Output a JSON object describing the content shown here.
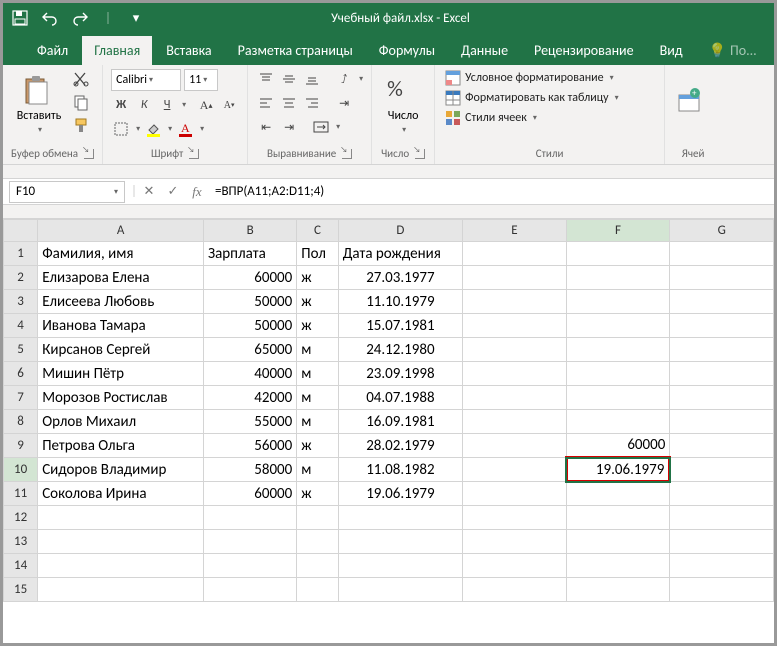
{
  "title": "Учебный файл.xlsx - Excel",
  "tabs": [
    "Файл",
    "Главная",
    "Вставка",
    "Разметка страницы",
    "Формулы",
    "Данные",
    "Рецензирование",
    "Вид"
  ],
  "search": "По...",
  "ribbon": {
    "clipboard": {
      "paste": "Вставить",
      "label": "Буфер обмена"
    },
    "font": {
      "name": "Calibri",
      "size": "11",
      "bold": "Ж",
      "italic": "К",
      "underline": "Ч",
      "label": "Шрифт"
    },
    "align": {
      "label": "Выравнивание"
    },
    "number": {
      "btn": "Число",
      "label": "Число"
    },
    "styles": {
      "cond": "Условное форматирование",
      "table": "Форматировать как таблицу",
      "cell": "Стили ячеек",
      "label": "Стили"
    },
    "cells": {
      "label": "Ячей"
    }
  },
  "namebox": "F10",
  "formula": "=ВПР(A11;A2:D11;4)",
  "cols": [
    "",
    "A",
    "B",
    "C",
    "D",
    "E",
    "F",
    "G"
  ],
  "rows": [
    {
      "n": 1,
      "A": "Фамилия, имя",
      "B": "Зарплата",
      "C": "Пол",
      "D": "Дата рождения",
      "E": "",
      "F": "",
      "al": {
        "B": "",
        "D": ""
      }
    },
    {
      "n": 2,
      "A": "Елизарова Елена",
      "B": "60000",
      "C": "ж",
      "D": "27.03.1977",
      "E": "",
      "F": ""
    },
    {
      "n": 3,
      "A": "Елисеева Любовь",
      "B": "50000",
      "C": "ж",
      "D": "11.10.1979",
      "E": "",
      "F": ""
    },
    {
      "n": 4,
      "A": "Иванова Тамара",
      "B": "50000",
      "C": "ж",
      "D": "15.07.1981",
      "E": "",
      "F": ""
    },
    {
      "n": 5,
      "A": "Кирсанов Сергей",
      "B": "65000",
      "C": "м",
      "D": "24.12.1980",
      "E": "",
      "F": ""
    },
    {
      "n": 6,
      "A": "Мишин Пётр",
      "B": "40000",
      "C": "м",
      "D": "23.09.1998",
      "E": "",
      "F": ""
    },
    {
      "n": 7,
      "A": "Морозов Ростислав",
      "B": "42000",
      "C": "м",
      "D": "04.07.1988",
      "E": "",
      "F": ""
    },
    {
      "n": 8,
      "A": "Орлов Михаил",
      "B": "55000",
      "C": "м",
      "D": "16.09.1981",
      "E": "",
      "F": ""
    },
    {
      "n": 9,
      "A": "Петрова Ольга",
      "B": "56000",
      "C": "ж",
      "D": "28.02.1979",
      "E": "",
      "F": "60000"
    },
    {
      "n": 10,
      "A": "Сидоров Владимир",
      "B": "58000",
      "C": "м",
      "D": "11.08.1982",
      "E": "",
      "F": "19.06.1979",
      "sel": true,
      "hl": true
    },
    {
      "n": 11,
      "A": "Соколова Ирина",
      "B": "60000",
      "C": "ж",
      "D": "19.06.1979",
      "E": "",
      "F": ""
    },
    {
      "n": 12,
      "A": "",
      "B": "",
      "C": "",
      "D": "",
      "E": "",
      "F": ""
    },
    {
      "n": 13,
      "A": "",
      "B": "",
      "C": "",
      "D": "",
      "E": "",
      "F": ""
    },
    {
      "n": 14,
      "A": "",
      "B": "",
      "C": "",
      "D": "",
      "E": "",
      "F": ""
    },
    {
      "n": 15,
      "A": "",
      "B": "",
      "C": "",
      "D": "",
      "E": "",
      "F": ""
    }
  ]
}
